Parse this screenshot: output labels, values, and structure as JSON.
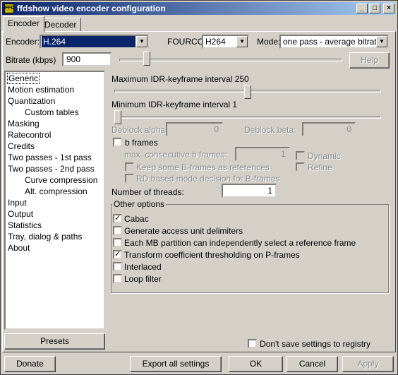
{
  "window": {
    "title": "ffdshow video encoder configuration",
    "app_icon_text": "FFD",
    "buttons": [
      "_",
      "□",
      "×"
    ]
  },
  "tabs": [
    {
      "label": "Encoder",
      "active": true
    },
    {
      "label": "Decoder",
      "active": false
    }
  ],
  "top": {
    "encoder_label": "Encoder:",
    "encoder_value": "H.264",
    "fourcc_label": "FOURCC:",
    "fourcc_value": "H264",
    "mode_label": "Mode:",
    "mode_value": "one pass - average bitrate",
    "bitrate_label": "Bitrate (kbps)",
    "bitrate_value": "900",
    "bitrate_slider_level": 0.11,
    "help_label": "Help"
  },
  "tree": {
    "items": [
      {
        "label": "Generic",
        "child": false,
        "selected": true
      },
      {
        "label": "Motion estimation",
        "child": false
      },
      {
        "label": "Quantization",
        "child": false
      },
      {
        "label": "Custom tables",
        "child": true
      },
      {
        "label": "Masking",
        "child": false
      },
      {
        "label": "Ratecontrol",
        "child": false
      },
      {
        "label": "Credits",
        "child": false
      },
      {
        "label": "Two passes - 1st pass",
        "child": false
      },
      {
        "label": "Two passes - 2nd pass",
        "child": false
      },
      {
        "label": "Curve compression",
        "child": true
      },
      {
        "label": "Alt. compression",
        "child": true
      },
      {
        "label": "Input",
        "child": false
      },
      {
        "label": "Output",
        "child": false
      },
      {
        "label": "Statistics",
        "child": false
      },
      {
        "label": "Tray, dialog & paths",
        "child": false
      },
      {
        "label": "About",
        "child": false
      }
    ],
    "presets_label": "Presets"
  },
  "generic": {
    "max_idr_label": "Maximum IDR-keyframe interval 250",
    "max_idr_level": 0.5,
    "min_idr_label": "Minimum IDR-keyframe interval 1",
    "min_idr_level": 0.0,
    "deblock_alpha_label": "Deblock alpha:",
    "deblock_alpha_value": "0",
    "deblock_beta_label": "Deblock beta:",
    "deblock_beta_value": "0",
    "bframes_label": "b frames",
    "max_consec_label": "max. consecutive b frames:",
    "max_consec_value": "1",
    "dynamic_label": "Dynamic",
    "refine_label": "Refine",
    "keep_bframes_label": "Keep some B-frames as references",
    "rd_mode_label": "RD based mode decision for B-frames",
    "threads_label": "Number of threads:",
    "threads_value": "1"
  },
  "other_options": {
    "title": "Other options",
    "items": [
      {
        "label": "Cabac",
        "checked": true
      },
      {
        "label": "Generate access unit delimiters",
        "checked": false
      },
      {
        "label": "Each MB partition can independently select a reference frame",
        "checked": false
      },
      {
        "label": "Transform coefficient thresholding on P-frames",
        "checked": true
      },
      {
        "label": "Interlaced",
        "checked": false
      },
      {
        "label": "Loop filter",
        "checked": false
      }
    ]
  },
  "registry_label": "Don't save settings to registry",
  "bottom_buttons": {
    "donate": "Donate",
    "export": "Export all settings",
    "ok": "OK",
    "cancel": "Cancel",
    "apply": "Apply"
  }
}
